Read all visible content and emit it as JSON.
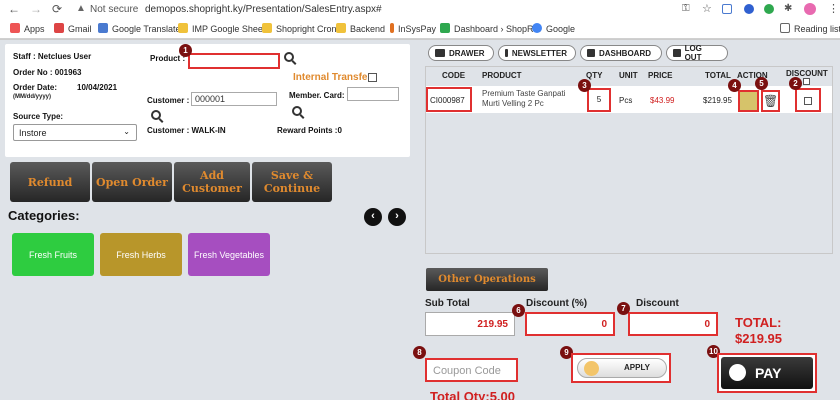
{
  "browser": {
    "not_secure": "Not secure",
    "url": "demopos.shopright.ky/Presentation/SalesEntry.aspx#",
    "bookmarks": [
      "Apps",
      "Gmail",
      "Google Translate",
      "IMP Google Sheet",
      "Shopright Cron",
      "Backend",
      "InSysPay",
      "Dashboard › ShopR...",
      "Google"
    ],
    "reading_list": "Reading list"
  },
  "form": {
    "staff": "Staff : Netclues User",
    "order_no": "Order No : 001963",
    "order_date_label": "Order Date:",
    "order_date_fmt": "(MM/dd/yyyy)",
    "order_date": "10/04/2021",
    "source_type_label": "Source Type:",
    "source_type_value": "Instore",
    "product_label": "Product :",
    "product_value": "",
    "internal_transfer": "Internal Transfer",
    "customer_label": "Customer :",
    "customer_value": "000001",
    "member_card_label": "Member. Card:",
    "customer_name": "Customer : WALK-IN",
    "reward_points": "Reward Points :0"
  },
  "actions": {
    "refund": "Refund",
    "open_order": "Open Order",
    "add_customer": "Add Customer",
    "save_continue": "Save & Continue"
  },
  "categories": {
    "heading": "Categories:",
    "items": [
      "Fresh Fruits",
      "Fresh Herbs",
      "Fresh Vegetables"
    ]
  },
  "top_buttons": {
    "drawer": "DRAWER",
    "newsletter": "NEWSLETTER",
    "dashboard": "DASHBOARD",
    "logout": "LOG OUT"
  },
  "table": {
    "headers": {
      "code": "CODE",
      "product": "PRODUCT",
      "qty": "QTY",
      "unit": "UNIT",
      "price": "PRICE",
      "total": "TOTAL",
      "action": "ACTION",
      "discount": "DISCOUNT"
    },
    "rows": [
      {
        "code": "CI000987",
        "product": "Premium Taste Ganpati Murti Velling 2 Pc",
        "qty": "5",
        "unit": "Pcs",
        "price": "$43.99",
        "total": "$219.95"
      }
    ]
  },
  "other_operations": "Other Operations",
  "totals": {
    "sub_total_label": "Sub Total",
    "sub_total": "219.95",
    "discount_pct_label": "Discount (%)",
    "discount_pct": "0",
    "discount_label": "Discount",
    "discount": "0",
    "total_label": "TOTAL:",
    "total_value": "$219.95",
    "coupon_placeholder": "Coupon Code",
    "apply": "APPLY",
    "pay": "PAY",
    "total_qty": "Total Qty:5.00"
  },
  "badges": [
    "1",
    "2",
    "3",
    "4",
    "5",
    "6",
    "7",
    "8",
    "9",
    "10"
  ],
  "colors": {
    "accent_red": "#e03030",
    "badge": "#7a1010",
    "orange": "#e08a2e",
    "cat_fruits": "#2ecc40",
    "cat_herbs": "#b8962a",
    "cat_veg": "#a64ec0"
  }
}
